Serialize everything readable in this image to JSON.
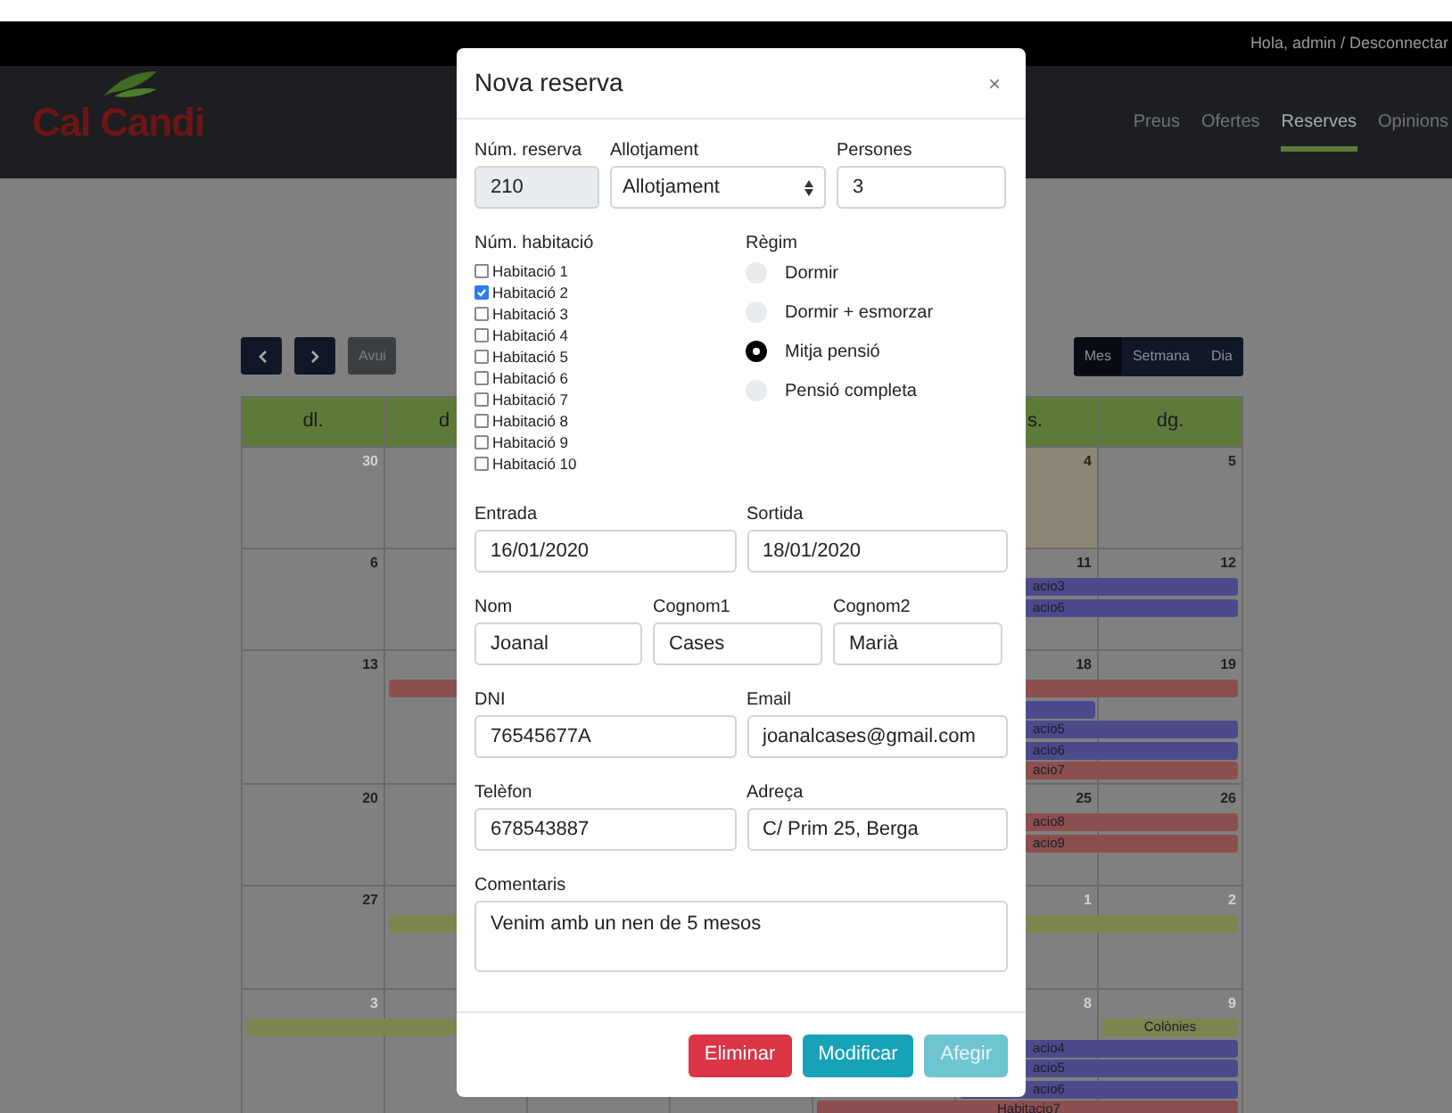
{
  "top_bar": {
    "greeting": "Hola, admin / Desconnectar"
  },
  "nav": {
    "logo": "Cal Candi",
    "links": [
      {
        "label": "Preus",
        "selected": false
      },
      {
        "label": "Ofertes",
        "selected": false
      },
      {
        "label": "Reserves",
        "selected": true
      },
      {
        "label": "Opinions",
        "selected": false
      }
    ]
  },
  "calendar": {
    "today_button": "Avui",
    "views": [
      {
        "label": "Mes",
        "selected": true
      },
      {
        "label": "Setmana",
        "selected": false
      },
      {
        "label": "Dia",
        "selected": false
      }
    ],
    "headers": [
      {
        "kind": "label",
        "label": "dl."
      },
      {
        "kind": "label",
        "label": "d"
      },
      {
        "kind": "hidden"
      },
      {
        "kind": "hidden"
      },
      {
        "kind": "hidden"
      },
      {
        "kind": "label",
        "label": "s."
      },
      {
        "kind": "label",
        "label": "dg."
      }
    ],
    "weeks": [
      {
        "days": [
          {
            "kind": "day",
            "label": "30",
            "muted": true,
            "today": false
          },
          {
            "kind": "hidden"
          },
          {
            "kind": "hidden"
          },
          {
            "kind": "hidden"
          },
          {
            "kind": "hidden"
          },
          {
            "kind": "day",
            "label": "4",
            "muted": false,
            "today": true
          },
          {
            "kind": "day",
            "label": "5",
            "muted": false,
            "today": false
          }
        ]
      },
      {
        "days": [
          {
            "kind": "day",
            "label": "6",
            "muted": false,
            "today": false
          },
          {
            "kind": "hidden"
          },
          {
            "kind": "hidden"
          },
          {
            "kind": "hidden"
          },
          {
            "kind": "hidden"
          },
          {
            "kind": "day",
            "label": "11",
            "muted": false,
            "today": false
          },
          {
            "kind": "day",
            "label": "12",
            "muted": false,
            "today": false
          }
        ],
        "lanes": [
          [
            {
              "kind": "empty"
            },
            {
              "kind": "empty"
            },
            {
              "kind": "empty"
            },
            {
              "kind": "empty"
            },
            {
              "kind": "empty"
            },
            {
              "kind": "start",
              "color": "#4b4b8c",
              "label": "acio3"
            },
            {
              "kind": "continue"
            }
          ],
          [
            {
              "kind": "empty"
            },
            {
              "kind": "empty"
            },
            {
              "kind": "empty"
            },
            {
              "kind": "empty"
            },
            {
              "kind": "empty"
            },
            {
              "kind": "start",
              "color": "#4b4b8c",
              "label": "acio6"
            },
            {
              "kind": "continue"
            }
          ]
        ]
      },
      {
        "days": [
          {
            "kind": "day",
            "label": "13",
            "muted": false,
            "today": false
          },
          {
            "kind": "hidden"
          },
          {
            "kind": "hidden"
          },
          {
            "kind": "hidden"
          },
          {
            "kind": "hidden"
          },
          {
            "kind": "day",
            "label": "18",
            "muted": false,
            "today": false
          },
          {
            "kind": "day",
            "label": "19",
            "muted": false,
            "today": false
          }
        ],
        "lanes": [
          [
            {
              "kind": "empty"
            },
            {
              "kind": "start",
              "color": "#8c4f4f"
            },
            {
              "kind": "continue"
            },
            {
              "kind": "continue"
            },
            {
              "kind": "continue"
            },
            {
              "kind": "continue"
            },
            {
              "kind": "continue"
            }
          ],
          [
            {
              "kind": "empty"
            },
            {
              "kind": "empty"
            },
            {
              "kind": "empty"
            },
            {
              "kind": "start",
              "color": "#4b4b8c"
            },
            {
              "kind": "continue"
            },
            {
              "kind": "continue"
            },
            {
              "kind": "empty"
            }
          ],
          [
            {
              "kind": "empty"
            },
            {
              "kind": "empty"
            },
            {
              "kind": "empty"
            },
            {
              "kind": "empty"
            },
            {
              "kind": "empty"
            },
            {
              "kind": "start",
              "color": "#4b4b8c",
              "label": "acio5"
            },
            {
              "kind": "continue"
            }
          ],
          [
            {
              "kind": "empty"
            },
            {
              "kind": "empty"
            },
            {
              "kind": "empty"
            },
            {
              "kind": "empty"
            },
            {
              "kind": "empty"
            },
            {
              "kind": "start",
              "color": "#4b4b8c",
              "label": "acio6"
            },
            {
              "kind": "continue"
            }
          ],
          [
            {
              "kind": "empty"
            },
            {
              "kind": "empty"
            },
            {
              "kind": "empty"
            },
            {
              "kind": "empty"
            },
            {
              "kind": "empty"
            },
            {
              "kind": "start",
              "color": "#8c4f4f",
              "label": "acio7"
            },
            {
              "kind": "continue"
            }
          ]
        ]
      },
      {
        "days": [
          {
            "kind": "day",
            "label": "20",
            "muted": false,
            "today": false
          },
          {
            "kind": "hidden"
          },
          {
            "kind": "hidden"
          },
          {
            "kind": "hidden"
          },
          {
            "kind": "hidden"
          },
          {
            "kind": "day",
            "label": "25",
            "muted": false,
            "today": false
          },
          {
            "kind": "day",
            "label": "26",
            "muted": false,
            "today": false
          }
        ],
        "lanes": [
          [
            {
              "kind": "empty"
            },
            {
              "kind": "empty"
            },
            {
              "kind": "empty"
            },
            {
              "kind": "empty"
            },
            {
              "kind": "empty"
            },
            {
              "kind": "start",
              "color": "#8c4f4f",
              "label": "acio8"
            },
            {
              "kind": "continue"
            }
          ],
          [
            {
              "kind": "empty"
            },
            {
              "kind": "empty"
            },
            {
              "kind": "empty"
            },
            {
              "kind": "empty"
            },
            {
              "kind": "empty"
            },
            {
              "kind": "start",
              "color": "#8c4f4f",
              "label": "acio9"
            },
            {
              "kind": "continue"
            }
          ]
        ]
      },
      {
        "days": [
          {
            "kind": "day",
            "label": "27",
            "muted": false,
            "today": false
          },
          {
            "kind": "hidden"
          },
          {
            "kind": "hidden"
          },
          {
            "kind": "hidden"
          },
          {
            "kind": "hidden"
          },
          {
            "kind": "day",
            "label": "1",
            "muted": true,
            "today": false
          },
          {
            "kind": "day",
            "label": "2",
            "muted": true,
            "today": false
          }
        ],
        "lanes": [
          [
            {
              "kind": "empty"
            },
            {
              "kind": "start",
              "color": "#7d8450"
            },
            {
              "kind": "continue"
            },
            {
              "kind": "continue"
            },
            {
              "kind": "continue"
            },
            {
              "kind": "continue"
            },
            {
              "kind": "continue"
            }
          ]
        ]
      },
      {
        "days": [
          {
            "kind": "day",
            "label": "3",
            "muted": true,
            "today": false
          },
          {
            "kind": "hidden"
          },
          {
            "kind": "hidden"
          },
          {
            "kind": "hidden"
          },
          {
            "kind": "hidden"
          },
          {
            "kind": "day",
            "label": "8",
            "muted": true,
            "today": false
          },
          {
            "kind": "day",
            "label": "9",
            "muted": true,
            "today": false
          }
        ],
        "lanes": [
          [
            {
              "kind": "start",
              "color": "#7d8450"
            },
            {
              "kind": "continue"
            },
            {
              "kind": "continue"
            },
            {
              "kind": "continue"
            },
            {
              "kind": "empty"
            },
            {
              "kind": "empty"
            },
            {
              "kind": "start",
              "color": "#7d8450",
              "label": "Colònies"
            }
          ],
          [
            {
              "kind": "empty"
            },
            {
              "kind": "empty"
            },
            {
              "kind": "empty"
            },
            {
              "kind": "empty"
            },
            {
              "kind": "empty"
            },
            {
              "kind": "start",
              "color": "#4b4b8c",
              "label": "acio4"
            },
            {
              "kind": "continue"
            }
          ],
          [
            {
              "kind": "empty"
            },
            {
              "kind": "empty"
            },
            {
              "kind": "empty"
            },
            {
              "kind": "empty"
            },
            {
              "kind": "empty"
            },
            {
              "kind": "start",
              "color": "#4b4b8c",
              "label": "acio5"
            },
            {
              "kind": "continue"
            }
          ],
          [
            {
              "kind": "empty"
            },
            {
              "kind": "empty"
            },
            {
              "kind": "empty"
            },
            {
              "kind": "empty"
            },
            {
              "kind": "empty"
            },
            {
              "kind": "start",
              "color": "#4b4b8c",
              "label": "acio6"
            },
            {
              "kind": "continue"
            }
          ],
          [
            {
              "kind": "empty"
            },
            {
              "kind": "empty"
            },
            {
              "kind": "empty"
            },
            {
              "kind": "empty"
            },
            {
              "kind": "start",
              "color": "#8c4f4f",
              "label": "Habitacio7"
            },
            {
              "kind": "continue"
            },
            {
              "kind": "continue"
            }
          ]
        ]
      }
    ]
  },
  "modal": {
    "title": "Nova reserva",
    "close": "×",
    "top_row": [
      {
        "label": "Núm. reserva",
        "kind": "readonly",
        "value": "210"
      },
      {
        "label": "Allotjament",
        "kind": "select",
        "value": "Allotjament"
      },
      {
        "label": "Persones",
        "kind": "text",
        "value": "3"
      }
    ],
    "rooms": {
      "label": "Núm. habitació",
      "items": [
        {
          "label": "Habitació 1",
          "checked": false
        },
        {
          "label": "Habitació 2",
          "checked": true
        },
        {
          "label": "Habitació 3",
          "checked": false
        },
        {
          "label": "Habitació 4",
          "checked": false
        },
        {
          "label": "Habitació 5",
          "checked": false
        },
        {
          "label": "Habitació 6",
          "checked": false
        },
        {
          "label": "Habitació 7",
          "checked": false
        },
        {
          "label": "Habitació 8",
          "checked": false
        },
        {
          "label": "Habitació 9",
          "checked": false
        },
        {
          "label": "Habitació 10",
          "checked": false
        }
      ]
    },
    "regime": {
      "label": "Règim",
      "options": [
        {
          "label": "Dormir",
          "selected": false
        },
        {
          "label": "Dormir + esmorzar",
          "selected": false
        },
        {
          "label": "Mitja pensió",
          "selected": true
        },
        {
          "label": "Pensió completa",
          "selected": false
        }
      ]
    },
    "rows": [
      [
        {
          "label": "Entrada",
          "kind": "text",
          "value": "16/01/2020"
        },
        {
          "label": "Sortida",
          "kind": "text",
          "value": "18/01/2020"
        }
      ],
      [
        {
          "label": "Nom",
          "kind": "text",
          "value": "Joanal"
        },
        {
          "label": "Cognom1",
          "kind": "text",
          "value": "Cases"
        },
        {
          "label": "Cognom2",
          "kind": "text",
          "value": "Marià"
        }
      ],
      [
        {
          "label": "DNI",
          "kind": "text",
          "value": "76545677A"
        },
        {
          "label": "Email",
          "kind": "text",
          "value": "joanalcases@gmail.com"
        }
      ],
      [
        {
          "label": "Telèfon",
          "kind": "text",
          "value": "678543887"
        },
        {
          "label": "Adreça",
          "kind": "text",
          "value": "C/ Prim 25, Berga"
        }
      ],
      [
        {
          "label": "Comentaris",
          "kind": "textarea",
          "value": "Venim amb un nen de 5 mesos"
        }
      ]
    ],
    "buttons": [
      {
        "label": "Eliminar",
        "kind": "danger"
      },
      {
        "label": "Modificar",
        "kind": "primary"
      },
      {
        "label": "Afegir",
        "kind": "disabled"
      }
    ]
  }
}
